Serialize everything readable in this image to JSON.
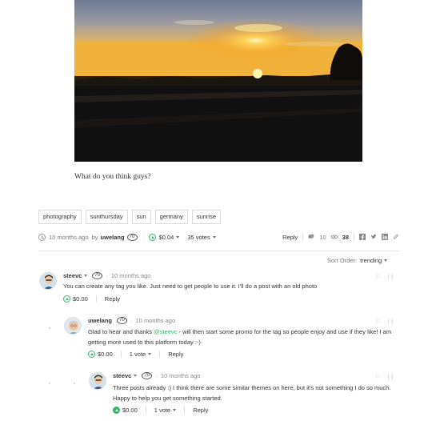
{
  "post": {
    "body": "What do you think guys?",
    "tags": [
      "photography",
      "sunthursday",
      "sun",
      "germany",
      "sunrise"
    ],
    "time": "10 months ago",
    "by": "by",
    "author": "uwelang",
    "reputation": "70",
    "payout": "$0.04",
    "votes": "35 votes",
    "reply": "Reply",
    "comments_count": "10",
    "views_count": "38"
  },
  "sort": {
    "label": "Sort Order:",
    "value": "trending"
  },
  "comments": [
    {
      "author": "steevc",
      "reputation": "70",
      "time": "10 months ago",
      "body": "You can create any tag you like. Just need to get people to use it. I'll do a post with an old photo",
      "payout": "$0.00",
      "votes": "",
      "reply": "Reply",
      "collapse": "[-]"
    },
    {
      "author": "uwelang",
      "reputation": "70",
      "time": "10 months ago",
      "body_before": "Glad to hear and thanks ",
      "mention": "@steevc",
      "body_after": " - will then start some promo for the tag so people enjoy and use if they like! I am getting more used to this platform today :-)",
      "payout": "$0.00",
      "votes": "1 vote",
      "reply": "Reply",
      "collapse": "[-]"
    },
    {
      "author": "steevc",
      "reputation": "70",
      "time": "10 months ago",
      "body": "Three posts already :) I think there are some similar themes on here, but it's not something I do so much. Happy to help you get something started.",
      "payout": "$0.00",
      "votes": "1 vote",
      "reply": "Reply",
      "collapse": "[-]"
    }
  ],
  "colors": {
    "accent_green": "#37b56a",
    "accent_blue": "#4ba2f2"
  },
  "icons": [
    "clock-icon",
    "upvote-icon",
    "chevron-down-icon",
    "comments-icon",
    "eye-icon",
    "facebook-icon",
    "twitter-icon",
    "linkedin-icon",
    "link-icon",
    "flag-icon",
    "avatar-icon"
  ]
}
